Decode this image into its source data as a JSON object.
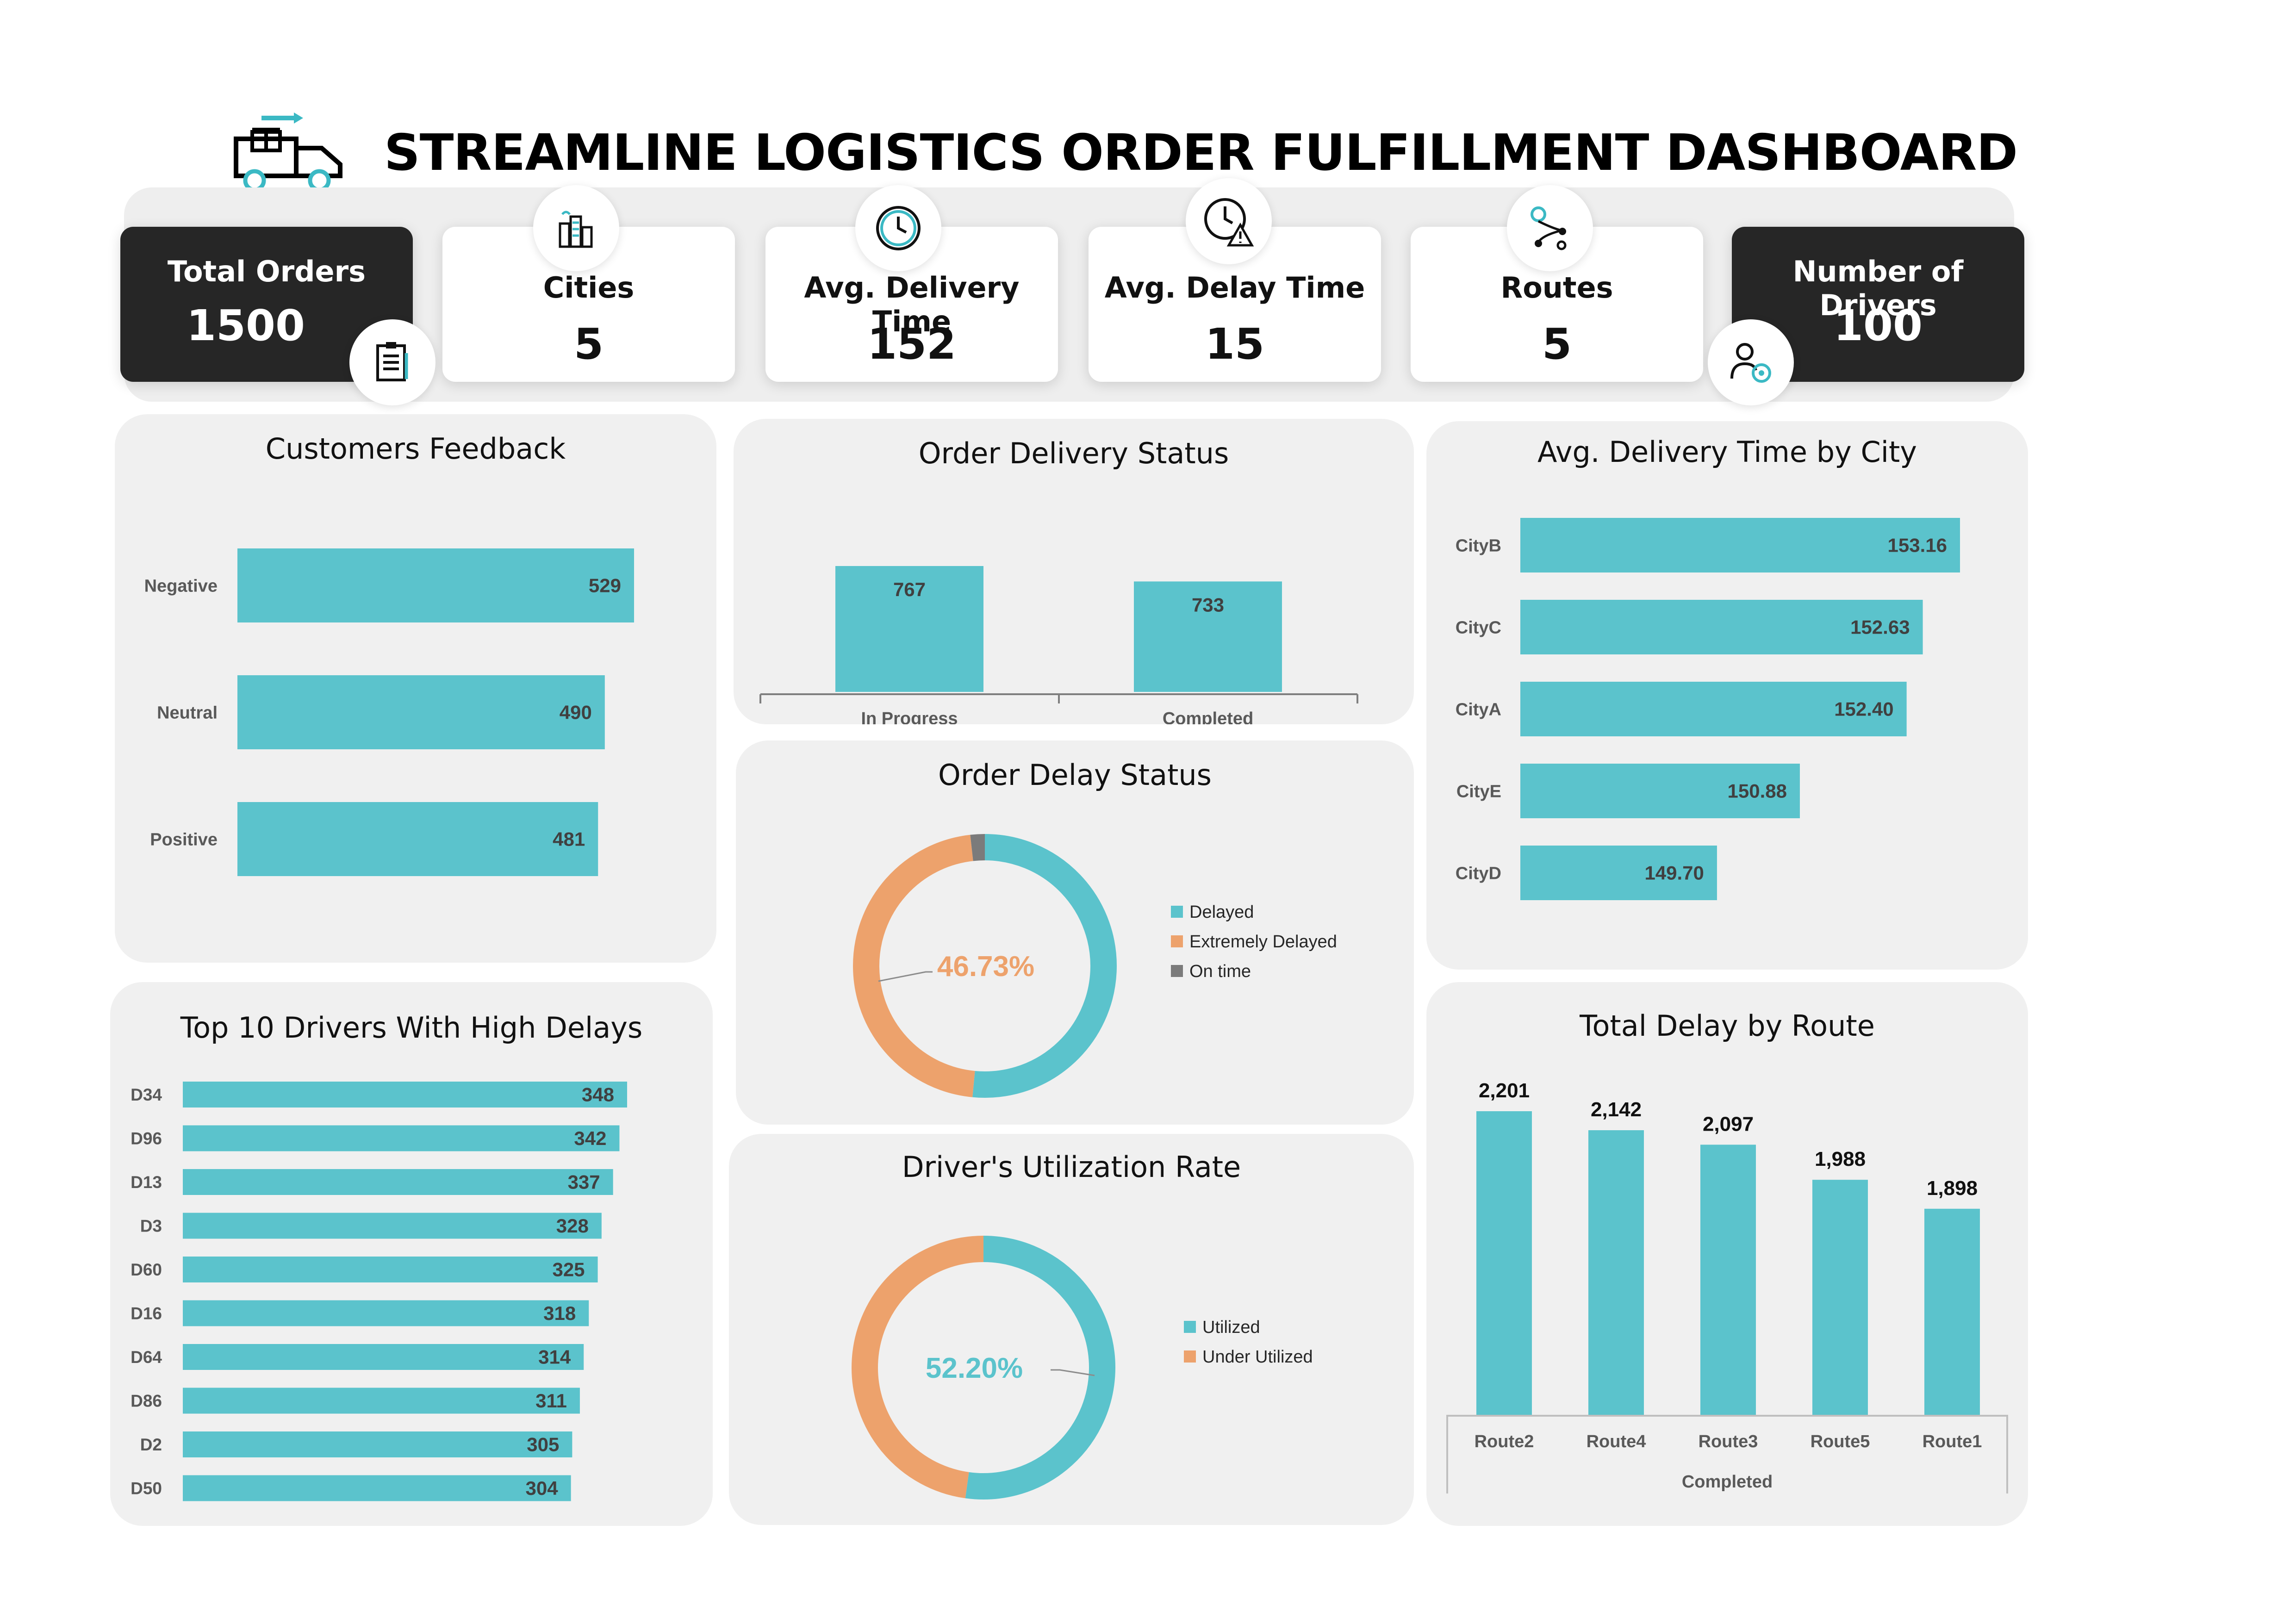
{
  "header": {
    "title": "STREAMLINE LOGISTICS ORDER FULFILLMENT DASHBOARD",
    "logo_icon": "delivery-truck-icon"
  },
  "colors": {
    "teal": "#5bc3cc",
    "orange": "#eda26c",
    "gray": "#7b7b7b",
    "dark_card": "#262626",
    "panel_bg": "#f0f0f0"
  },
  "kpis": [
    {
      "label": "Total Orders",
      "value": "1500",
      "icon": "clipboard-list-icon"
    },
    {
      "label": "Cities",
      "value": "5",
      "icon": "city-buildings-icon"
    },
    {
      "label": "Avg. Delivery Time",
      "value": "152",
      "icon": "clock-icon"
    },
    {
      "label": "Avg. Delay Time",
      "value": "15",
      "icon": "clock-warning-icon"
    },
    {
      "label": "Routes",
      "value": "5",
      "icon": "route-pin-icon"
    },
    {
      "label": "Number of Drivers",
      "value": "100",
      "icon": "driver-settings-icon"
    }
  ],
  "panels": {
    "feedback": "Customers Feedback",
    "delivery_status": "Order Delivery Status",
    "city_time": "Avg. Delivery Time by City",
    "drivers": "Top 10 Drivers With High Delays",
    "delay_status": "Order Delay Status",
    "utilization": "Driver's Utilization Rate",
    "route_delay": "Total Delay by Route"
  },
  "chart_data": [
    {
      "id": "feedback",
      "type": "bar",
      "orientation": "horizontal",
      "title": "Customers Feedback",
      "categories": [
        "Negative",
        "Neutral",
        "Positive"
      ],
      "values": [
        529,
        490,
        481
      ]
    },
    {
      "id": "delivery_status",
      "type": "bar",
      "title": "Order Delivery Status",
      "categories": [
        "In Progress",
        "Completed"
      ],
      "values": [
        767,
        733
      ]
    },
    {
      "id": "city_time",
      "type": "bar",
      "orientation": "horizontal",
      "title": "Avg. Delivery Time by City",
      "categories": [
        "CityB",
        "CityC",
        "CityA",
        "CityE",
        "CityD"
      ],
      "values": [
        153.16,
        152.63,
        152.4,
        150.88,
        149.7
      ],
      "labels": [
        "153.16",
        "152.63",
        "152.40",
        "150.88",
        "149.70"
      ]
    },
    {
      "id": "drivers",
      "type": "bar",
      "orientation": "horizontal",
      "title": "Top 10 Drivers With High Delays",
      "categories": [
        "D34",
        "D96",
        "D13",
        "D3",
        "D60",
        "D16",
        "D64",
        "D86",
        "D2",
        "D50"
      ],
      "values": [
        348,
        342,
        337,
        328,
        325,
        318,
        314,
        311,
        305,
        304
      ]
    },
    {
      "id": "delay_status",
      "type": "pie",
      "donut": true,
      "title": "Order Delay Status",
      "center_label": "46.73%",
      "legend": [
        "Delayed",
        "Extremely Delayed",
        "On time"
      ],
      "values": [
        51.5,
        46.73,
        1.77
      ],
      "legend_position": "right"
    },
    {
      "id": "utilization",
      "type": "pie",
      "donut": true,
      "title": "Driver's Utilization Rate",
      "center_label": "52.20%",
      "legend": [
        "Utilized",
        "Under Utilized"
      ],
      "values": [
        52.2,
        47.8
      ],
      "legend_position": "right"
    },
    {
      "id": "route_delay",
      "type": "bar",
      "title": "Total Delay by Route",
      "categories": [
        "Route2",
        "Route4",
        "Route3",
        "Route5",
        "Route1"
      ],
      "values": [
        2201,
        2142,
        2097,
        1988,
        1898
      ],
      "labels": [
        "2,201",
        "2,142",
        "2,097",
        "1,988",
        "1,898"
      ],
      "xgroup": "Completed"
    }
  ]
}
